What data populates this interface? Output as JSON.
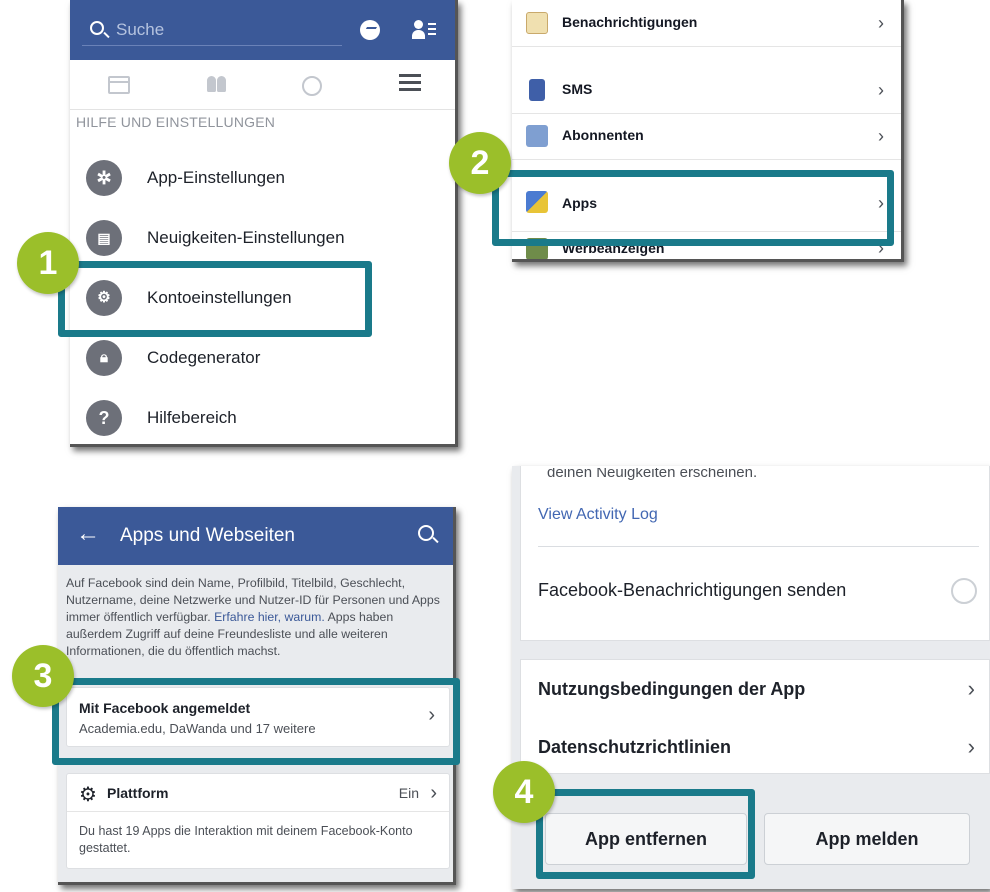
{
  "panel1": {
    "search_placeholder": "Suche",
    "section_title": "HILFE UND EINSTELLUNGEN",
    "menu": [
      {
        "label": "App-Einstellungen",
        "icon": "gear-icon"
      },
      {
        "label": "Neuigkeiten-Einstellungen",
        "icon": "news-feed-icon"
      },
      {
        "label": "Kontoeinstellungen",
        "icon": "account-settings-icon"
      },
      {
        "label": "Codegenerator",
        "icon": "lock-icon"
      },
      {
        "label": "Hilfebereich",
        "icon": "help-icon"
      }
    ]
  },
  "panel2": {
    "rows": [
      {
        "label": "Benachrichtigungen",
        "icon": "notification-icon"
      },
      {
        "label": "SMS",
        "icon": "phone-icon"
      },
      {
        "label": "Abonnenten",
        "icon": "rss-icon"
      },
      {
        "label": "Apps",
        "icon": "apps-cube-icon"
      },
      {
        "label": "Werbeanzeigen",
        "icon": "ads-icon"
      }
    ]
  },
  "panel3": {
    "title": "Apps und Webseiten",
    "info_text": "Auf Facebook sind dein Name, Profilbild, Titelbild, Geschlecht, Nutzername, deine Netzwerke und Nutzer-ID für Personen und Apps immer öffentlich verfügbar.",
    "info_link": "Erfahre hier, warum.",
    "info_text_2": "Apps haben außerdem Zugriff auf deine Freundesliste und alle weiteren Informationen, die du öffentlich machst.",
    "logged_in_title": "Mit Facebook angemeldet",
    "logged_in_sub": "Academia.edu, DaWanda und 17 weitere",
    "platform_title": "Plattform",
    "platform_value": "Ein",
    "platform_desc": "Du hast 19 Apps die Interaktion mit deinem Facebook-Konto gestattet."
  },
  "panel4": {
    "cut_text": "deinen Neuigkeiten erscheinen.",
    "activity_link": "View Activity Log",
    "notif_label": "Facebook-Benachrichtigungen senden",
    "terms": "Nutzungsbedingungen der App",
    "privacy": "Datenschutzrichtlinien",
    "remove_btn": "App entfernen",
    "report_btn": "App melden"
  },
  "steps": [
    "1",
    "2",
    "3",
    "4"
  ],
  "colors": {
    "facebook_blue": "#3b5998",
    "highlight": "#1a7a8a",
    "badge": "#9bbf2a"
  }
}
